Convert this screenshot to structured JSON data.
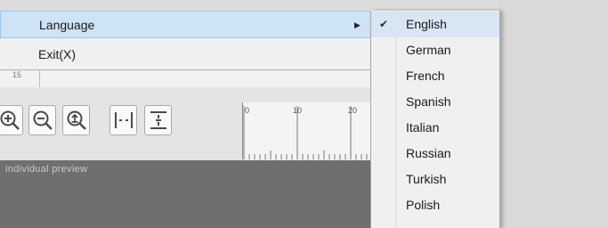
{
  "menu": {
    "items": [
      {
        "label": "Language",
        "has_submenu": true,
        "highlighted": true
      },
      {
        "label": "Exit(X)"
      }
    ]
  },
  "language_submenu": {
    "items": [
      {
        "label": "English",
        "checked": true
      },
      {
        "label": "German"
      },
      {
        "label": "French"
      },
      {
        "label": "Spanish"
      },
      {
        "label": "Italian"
      },
      {
        "label": "Russian"
      },
      {
        "label": "Turkish"
      },
      {
        "label": "Polish"
      }
    ]
  },
  "row_number": "15",
  "toolbar": {
    "buttons": [
      "zoom-in-icon",
      "zoom-out-icon",
      "zoom-fit-icon",
      "fit-width-icon",
      "fit-height-icon"
    ]
  },
  "ruler": {
    "labels": [
      "0",
      "10",
      "20"
    ]
  },
  "preview": {
    "label": "individual preview"
  }
}
